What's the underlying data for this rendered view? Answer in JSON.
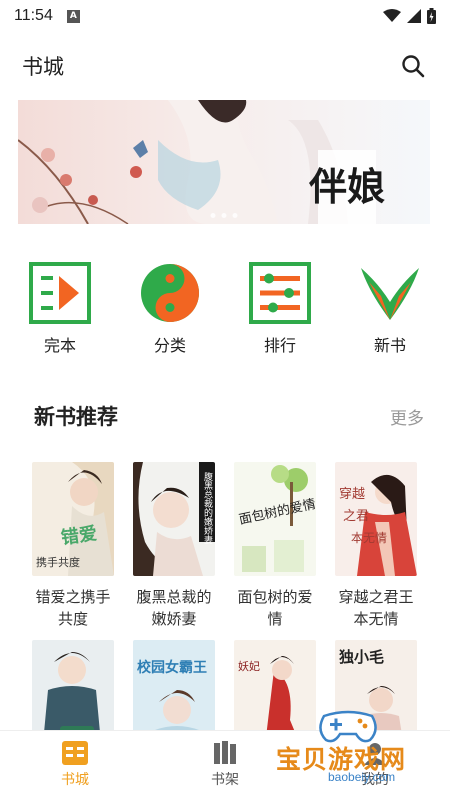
{
  "status": {
    "time": "11:54",
    "notif_letter": "A"
  },
  "header": {
    "title": "书城"
  },
  "banner": {
    "text": "伴娘"
  },
  "quick_nav": [
    {
      "label": "完本",
      "icon": "completed-books-icon"
    },
    {
      "label": "分类",
      "icon": "taichi-category-icon"
    },
    {
      "label": "排行",
      "icon": "ranking-list-icon"
    },
    {
      "label": "新书",
      "icon": "new-book-leaf-icon"
    }
  ],
  "section": {
    "title": "新书推荐",
    "more": "更多"
  },
  "books": [
    {
      "title": "错爱之携手共度",
      "cover_text": "错爱 携手共度"
    },
    {
      "title": "腹黑总裁的嫩娇妻",
      "cover_text": "腹黑总裁的嫩娇妻"
    },
    {
      "title": "面包树的爱情",
      "cover_text": "面包树的爱情"
    },
    {
      "title": "穿越之君王本无情",
      "cover_text": "穿越之君王本无情"
    },
    {
      "title": "",
      "cover_text": ""
    },
    {
      "title": "",
      "cover_text": "校园女霸王"
    },
    {
      "title": "",
      "cover_text": "妖妃"
    },
    {
      "title": "",
      "cover_text": "独小毛"
    }
  ],
  "bottom_nav": [
    {
      "label": "书城",
      "icon": "bookstore-icon",
      "active": true
    },
    {
      "label": "书架",
      "icon": "bookshelf-icon",
      "active": false
    },
    {
      "label": "我的",
      "icon": "profile-icon",
      "active": false
    }
  ],
  "watermark": {
    "text": "宝贝游戏网",
    "url": "baobeiy.com"
  },
  "colors": {
    "accent": "#f0a020",
    "green": "#2faa4a",
    "orange": "#f26522"
  }
}
